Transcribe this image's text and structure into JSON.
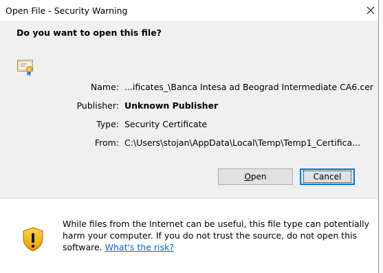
{
  "window": {
    "title": "Open File - Security Warning",
    "close_glyph": "✕"
  },
  "prompt": {
    "question": "Do you want to open this file?"
  },
  "file_info": {
    "icon": "certificate-icon",
    "name_label": "Name:",
    "name_value": "...ificates_\\Banca Intesa ad Beograd Intermediate CA6.cer",
    "publisher_label": "Publisher:",
    "publisher_value": "Unknown Publisher",
    "type_label": "Type:",
    "type_value": "Security Certificate",
    "from_label": "From:",
    "from_value": "C:\\Users\\stojan\\AppData\\Local\\Temp\\Temp1_Certifica..."
  },
  "buttons": {
    "open_label_accel": "O",
    "open_label_rest": "pen",
    "cancel_label": "Cancel"
  },
  "warning": {
    "icon": "shield-warning-icon",
    "text": "While files from the Internet can be useful, this file type can potentially harm your computer. If you do not trust the source, do not open this software.",
    "link_text": "What's the risk?"
  },
  "colors": {
    "upper_background": "#f0f0f0",
    "lower_background": "#ffffff",
    "link": "#0066cc",
    "focus_border": "#0078d7"
  }
}
